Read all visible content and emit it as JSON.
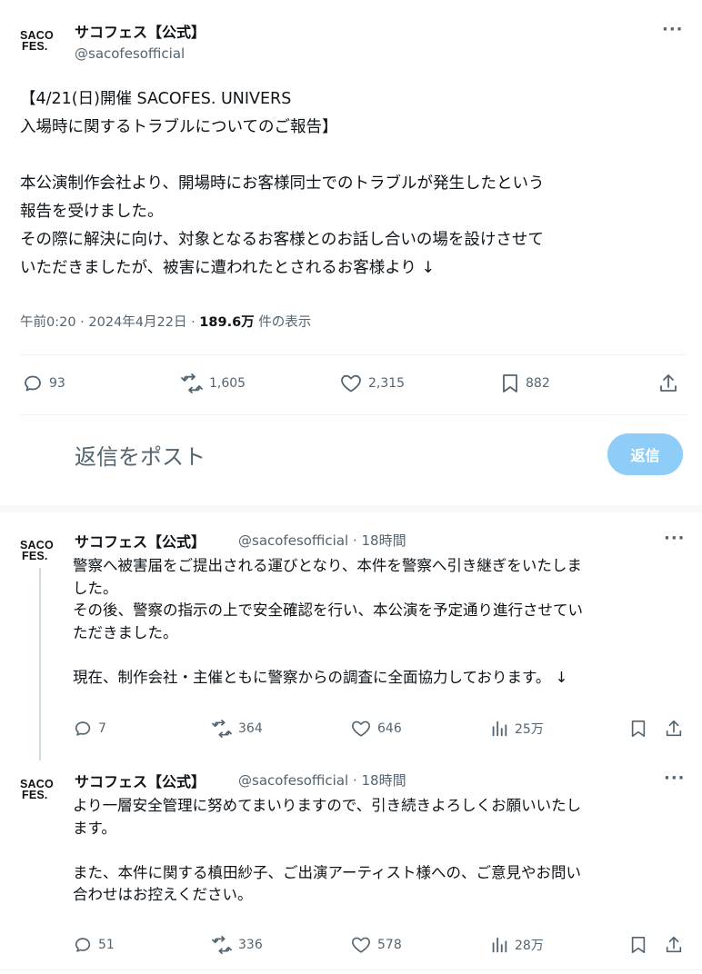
{
  "account": {
    "logo_line1": "SACO",
    "logo_line2": "FES.",
    "name": "サコフェス【公式】",
    "handle": "@sacofesofficial"
  },
  "main_tweet": {
    "title_line1": "【4/21(日)開催 SACOFES. UNIVERS",
    "title_line2": "入場時に関するトラブルについてのご報告】",
    "body_para1": "本公演制作会社より、開場時にお客様同士でのトラブルが発生したという\n報告を受けました。",
    "body_para2": "その際に解決に向け、対象となるお客様とのお話し合いの場を設けさせて\nいただきましたが、被害に遭われたとされるお客様より ↓",
    "meta_prefix": "午前0:20 · 2024年4月22日 · ",
    "views": "189.6万",
    "views_suffix": " 件の表示",
    "stats": {
      "replies": "93",
      "reposts": "1,605",
      "likes": "2,315",
      "bookmarks": "882"
    },
    "more_label": "···"
  },
  "reply_box": {
    "placeholder": "返信をポスト",
    "button_label": "返信"
  },
  "replies": [
    {
      "handle_time": "@sacofesofficial · 18時間",
      "para1": "警察へ被害届をご提出される運びとなり、本件を警察へ引き継ぎをいたしま\nした。\nその後、警察の指示の上で安全確認を行い、本公演を予定通り進行させてい\nただきました。",
      "para2": "現在、制作会社・主催ともに警察からの調査に全面協力しております。 ↓",
      "stats": {
        "replies": "7",
        "reposts": "364",
        "likes": "646",
        "views": "25万"
      },
      "more_label": "···"
    },
    {
      "handle_time": "@sacofesofficial · 18時間",
      "para1": "より一層安全管理に努めてまいりますので、引き続きよろしくお願いいたし\nます。",
      "para2": "また、本件に関する槙田紗子、ご出演アーティスト様への、ご意見やお問い\n合わせはお控えください。",
      "stats": {
        "replies": "51",
        "reposts": "336",
        "likes": "578",
        "views": "28万"
      },
      "more_label": "···"
    }
  ],
  "colors": {
    "text": "#0f1419",
    "secondary": "#536471",
    "reply_button": "#8ecdf8",
    "divider": "#eff3f4"
  },
  "icons": [
    "reply-icon",
    "repost-icon",
    "like-icon",
    "bookmark-icon",
    "share-icon",
    "views-icon",
    "more-icon"
  ]
}
